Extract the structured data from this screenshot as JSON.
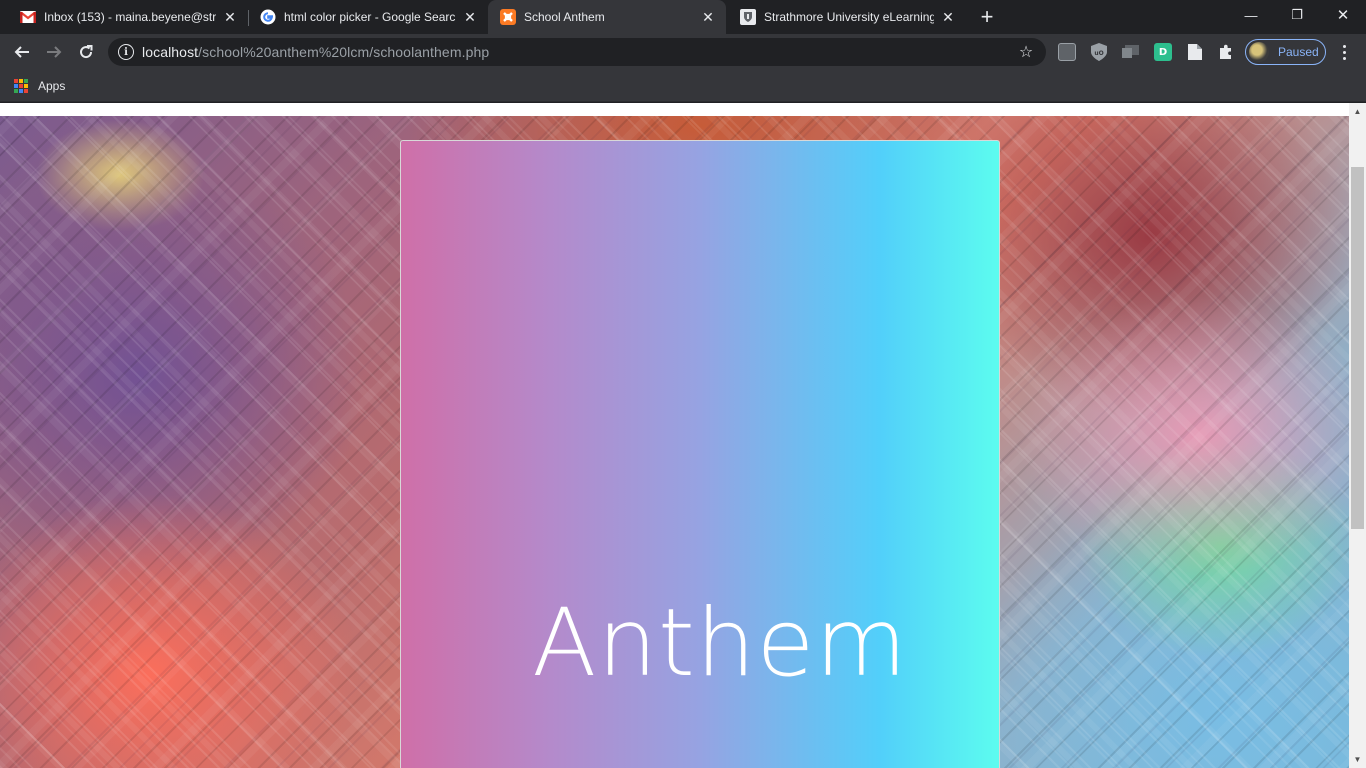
{
  "tabs": [
    {
      "title": "Inbox (153) - maina.beyene@stra",
      "favicon": "gmail-icon"
    },
    {
      "title": "html color picker - Google Searc",
      "favicon": "google-icon"
    },
    {
      "title": "School Anthem",
      "favicon": "xampp-icon",
      "active": true
    },
    {
      "title": "Strathmore University eLearning",
      "favicon": "strathmore-icon"
    }
  ],
  "tab_close_glyph": "✕",
  "new_tab_glyph": "+",
  "window_controls": {
    "minimize": "—",
    "restore": "❐",
    "close": "✕"
  },
  "toolbar": {
    "back_glyph": "←",
    "forward_glyph": "→",
    "reload_glyph": "↻",
    "url_host": "localhost",
    "url_path": "/school%20anthem%20lcm/schoolanthem.php",
    "star_glyph": "☆",
    "profile_label": "Paused"
  },
  "bookmarks": {
    "apps_label": "Apps"
  },
  "page": {
    "card_title": "Anthem"
  },
  "colors": {
    "card_gradient_start": "#cf6fa8",
    "card_gradient_mid": "#96a3e2",
    "card_gradient_end": "#5cfcef",
    "profile_accent": "#8ab4f8"
  }
}
